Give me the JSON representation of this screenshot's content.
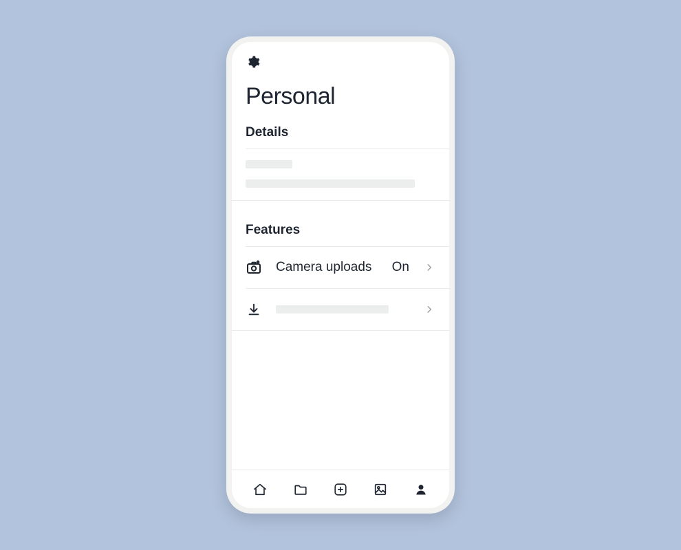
{
  "header": {
    "title": "Personal"
  },
  "sections": {
    "details_heading": "Details",
    "features_heading": "Features"
  },
  "features": {
    "camera_uploads": {
      "label": "Camera uploads",
      "value": "On"
    }
  }
}
